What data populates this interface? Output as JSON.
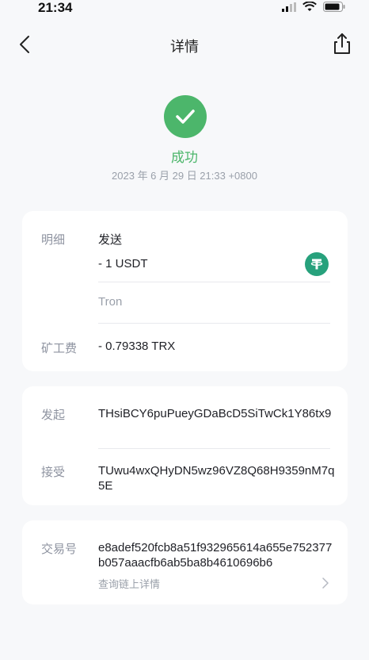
{
  "status_bar": {
    "time": "21:34"
  },
  "nav": {
    "title": "详情"
  },
  "result": {
    "status": "成功",
    "timestamp": "2023 年 6 月 29 日 21:33 +0800"
  },
  "detail": {
    "label": "明细",
    "type": "发送",
    "amount": "- 1 USDT",
    "network": "Tron",
    "fee_label": "矿工费",
    "fee": "- 0.79338 TRX"
  },
  "addresses": {
    "from_label": "发起",
    "from": "THsiBCY6puPueyGDaBcD5SiTwCk1Y86tx9",
    "to_label": "接受",
    "to": "TUwu4wxQHyDN5wz96VZ8Q68H9359nM7q5E"
  },
  "tx": {
    "label": "交易号",
    "hash": "e8adef520fcb8a51f932965614a655e752377b057aaacfb6ab5ba8b4610696b6",
    "link": "查询链上详情"
  },
  "colors": {
    "success": "#4cb66b",
    "usdt": "#27a17c",
    "background": "#f7f8fa"
  },
  "icons": [
    "back-arrow-icon",
    "share-icon",
    "check-icon",
    "usdt-icon",
    "chevron-right-icon"
  ]
}
